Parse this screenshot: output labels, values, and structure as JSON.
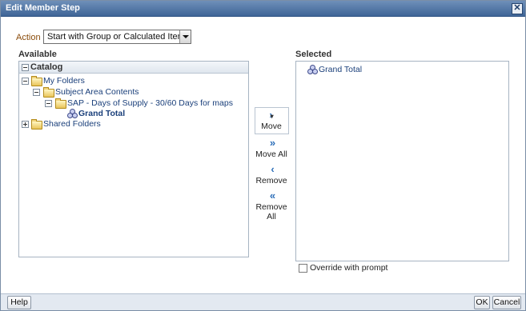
{
  "window": {
    "title": "Edit Member Step",
    "close_glyph": "✕"
  },
  "action": {
    "label": "Action",
    "selected": "Start with Group or Calculated Item"
  },
  "available": {
    "label": "Available",
    "catalog_label": "Catalog",
    "tree": {
      "my_folders": "My Folders",
      "subject_area_contents": "Subject Area Contents",
      "sap_item": "SAP - Days of Supply - 30/60 Days for maps",
      "grand_total": "Grand Total",
      "shared_folders": "Shared Folders"
    }
  },
  "selected": {
    "label": "Selected",
    "items": [
      "Grand Total"
    ]
  },
  "move_buttons": {
    "move": "Move",
    "move_all": "Move All",
    "remove": "Remove",
    "remove_all": "Remove All"
  },
  "override": {
    "label": "Override with prompt",
    "checked": false
  },
  "footer": {
    "help": "Help",
    "ok": "OK",
    "cancel": "Cancel"
  },
  "colors": {
    "titlebar": "#3f6597",
    "action_label": "#8a4b0a",
    "tree_text": "#1a3f7a"
  }
}
